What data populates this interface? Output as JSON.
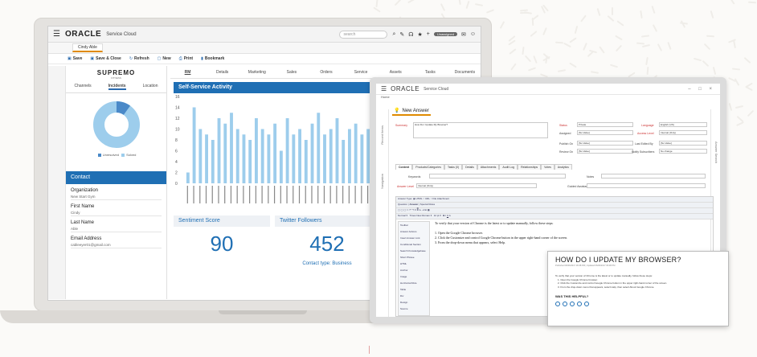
{
  "crm": {
    "brand": "ORACLE",
    "product": "Service Cloud",
    "search_placeholder": "search",
    "pill_label": "Unassigned",
    "record_tab": "Cindy Able",
    "toolbar": {
      "save": "Save",
      "save_close": "Save & Close",
      "refresh": "Refresh",
      "new": "New",
      "print": "Print",
      "bookmark": "Bookmark"
    },
    "logo": "SUPREMO",
    "logo_sub": "FITNESS",
    "subtabs": [
      "Channels",
      "Incidents",
      "Location"
    ],
    "legend": [
      "Unresolved",
      "Solved"
    ],
    "contact_title": "Contact",
    "fields": [
      {
        "label": "Organization",
        "value": "New Start Gym"
      },
      {
        "label": "First Name",
        "value": "Cindy"
      },
      {
        "label": "Last Name",
        "value": "Able"
      },
      {
        "label": "Email Address",
        "value": "cableeyer01@gmail.com"
      }
    ],
    "nav_tabs": [
      "RM",
      "Details",
      "Marketing",
      "Sales",
      "Orders",
      "Service",
      "Assets",
      "Tasks",
      "Documents"
    ],
    "activity_title": "Self-Service Activity",
    "sentiment_title": "Sentiment Score",
    "sentiment_value": "90",
    "twitter_title": "Twitter Followers",
    "twitter_value": "452",
    "contact_type": "Contact type: Business"
  },
  "chart_data": {
    "type": "bar",
    "title": "Self-Service Activity",
    "ylim": [
      0,
      16
    ],
    "yticks": [
      "0",
      "2",
      "4",
      "6",
      "8",
      "10",
      "12",
      "14",
      "16"
    ],
    "values": [
      2,
      14,
      10,
      9,
      8,
      12,
      11,
      13,
      10,
      9,
      8,
      12,
      10,
      9,
      11,
      6,
      12,
      9,
      10,
      8,
      11,
      13,
      9,
      10,
      12,
      8,
      10,
      11,
      9,
      10
    ],
    "color": "#9dcdec"
  },
  "donut": {
    "unresolved_fraction": 0.1,
    "color_solved": "#9dcdec",
    "color_unresolved": "#4a89c8"
  },
  "answer": {
    "brand": "ORACLE",
    "product": "Service Cloud",
    "home": "Home",
    "tab": "New Answer",
    "summary_label": "Summary",
    "summary_value": "How Do I Update My Browser?",
    "status_label": "Status",
    "status_value": "Private",
    "language_label": "Language",
    "language_value": "English (US)",
    "assigned_label": "Assigned",
    "assigned_value": "[No Value]",
    "access_label": "Access Level",
    "access_value": "Internal (Only)",
    "publish_label": "Publish On",
    "publish_value": "[No Value]",
    "last_edited_label": "Last Edited By",
    "last_edited_value": "[No Value]",
    "review_label": "Review On",
    "review_value": "[No Value]",
    "notify_label": "Notify Subscribers",
    "notify_value": "No change",
    "subtabs": [
      "Content",
      "Products/Categories",
      "Tasks (0)",
      "Details",
      "Attachments",
      "Audit Log",
      "Relationships",
      "Votes",
      "Analytics"
    ],
    "keywords_label": "Keywords",
    "notes_label": "Notes",
    "answer_level_label": "Answer Level",
    "answer_level_value": "Internal (Only)",
    "guided_label": "Guided Assistance",
    "answer_type_label": "Answer Type",
    "answer_type_options": [
      "HTML",
      "URL",
      "File Attachment"
    ],
    "editor_tabs": [
      "Question",
      "Answer",
      "Special Rules"
    ],
    "style_value": "Normal",
    "font_value": "Times New Roman",
    "size_value": "12 pt",
    "pane_items": [
      "Toolbar",
      "Answer Actions",
      "Insert Answer Link",
      "Conditional Section",
      "Search Knowledgebase",
      "Short Phrase",
      "HTML",
      "Anchor",
      "Image",
      "Horizontal Rule",
      "Table",
      "Div",
      "Design",
      "Source"
    ],
    "body_intro": "To verify that your version of Chrome is the latest or to update manually, follow these steps:",
    "body_steps": [
      "1.   Open the Google Chrome browser.",
      "2.   Click the Customize and control Google Chrome button in the upper right-hand corner of the screen.",
      "3.   From the drop-down menu that appears, select Help."
    ],
    "side_left": [
      "Record Items",
      "Navigation"
    ],
    "side_right": "Answer Search"
  },
  "article": {
    "title": "HOW DO I UPDATE MY BROWSER?",
    "meta": "Published 06/06/2017 06:38 PM  |  Updated 06/06/2017 06:38 PM",
    "text": "To verify that your version of Chrome is the latest or to update manually, follow these steps:",
    "steps": [
      "1. Open the Google Chrome browser.",
      "2. Click the Customize and control Google Chrome button in the upper right-hand corner of the screen.",
      "3. From the drop-down menu that appears, select Help, then select About Google Chrome."
    ],
    "helpful": "WAS THIS HELPFUL?",
    "rating_count": 5
  }
}
